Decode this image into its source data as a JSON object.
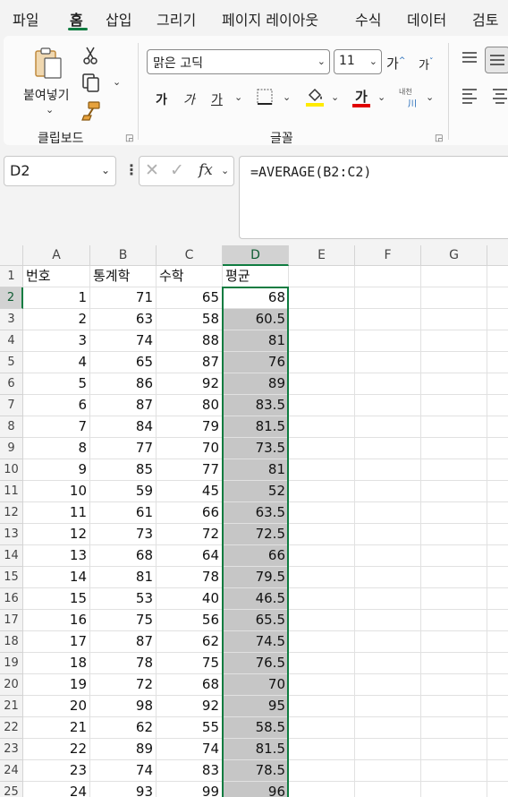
{
  "tabs": [
    "파일",
    "홈",
    "삽입",
    "그리기",
    "페이지 레이아웃",
    "수식",
    "데이터",
    "검토"
  ],
  "active_tab": "홈",
  "ribbon": {
    "clipboard": {
      "paste_label": "붙여넣기",
      "group_label": "클립보드"
    },
    "font": {
      "font_name": "맑은 고딕",
      "font_size": "11",
      "grow_label": "가",
      "shrink_label": "가",
      "bold": "가",
      "italic": "가",
      "underline": "가",
      "font_color_label": "가",
      "phonetic_top": "내천",
      "phonetic_bottom": "川",
      "group_label": "글꼴"
    }
  },
  "formula_bar": {
    "name_box": "D2",
    "formula": "=AVERAGE(B2:C2)"
  },
  "sheet": {
    "columns": [
      "A",
      "B",
      "C",
      "D",
      "E",
      "F",
      "G"
    ],
    "selected_column": "D",
    "header_row": [
      "번호",
      "통계학",
      "수학",
      "평균"
    ],
    "rows": [
      [
        "1",
        "71",
        "65",
        "68"
      ],
      [
        "2",
        "63",
        "58",
        "60.5"
      ],
      [
        "3",
        "74",
        "88",
        "81"
      ],
      [
        "4",
        "65",
        "87",
        "76"
      ],
      [
        "5",
        "86",
        "92",
        "89"
      ],
      [
        "6",
        "87",
        "80",
        "83.5"
      ],
      [
        "7",
        "84",
        "79",
        "81.5"
      ],
      [
        "8",
        "77",
        "70",
        "73.5"
      ],
      [
        "9",
        "85",
        "77",
        "81"
      ],
      [
        "10",
        "59",
        "45",
        "52"
      ],
      [
        "11",
        "61",
        "66",
        "63.5"
      ],
      [
        "12",
        "73",
        "72",
        "72.5"
      ],
      [
        "13",
        "68",
        "64",
        "66"
      ],
      [
        "14",
        "81",
        "78",
        "79.5"
      ],
      [
        "15",
        "53",
        "40",
        "46.5"
      ],
      [
        "16",
        "75",
        "56",
        "65.5"
      ],
      [
        "17",
        "87",
        "62",
        "74.5"
      ],
      [
        "18",
        "78",
        "75",
        "76.5"
      ],
      [
        "19",
        "72",
        "68",
        "70"
      ],
      [
        "20",
        "98",
        "92",
        "95"
      ],
      [
        "21",
        "62",
        "55",
        "58.5"
      ],
      [
        "22",
        "89",
        "74",
        "81.5"
      ],
      [
        "23",
        "74",
        "83",
        "78.5"
      ],
      [
        "24",
        "93",
        "99",
        "96"
      ]
    ]
  },
  "colors": {
    "accent": "#107c41",
    "selection_fill": "#c6c6c6"
  }
}
